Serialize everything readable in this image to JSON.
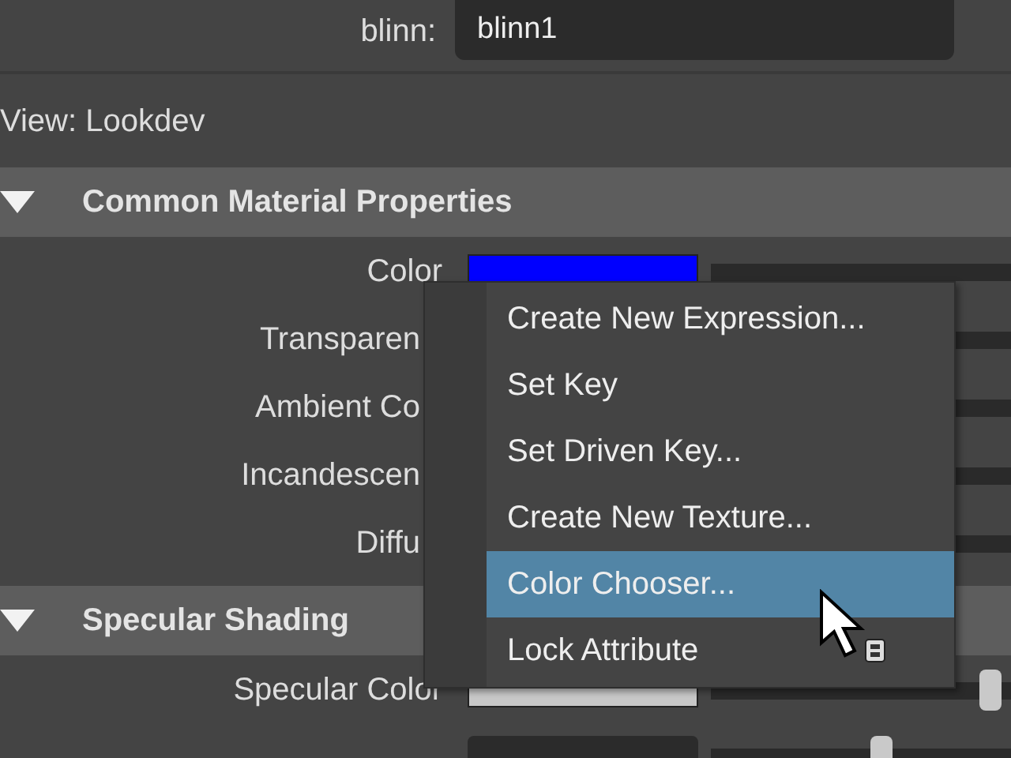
{
  "header": {
    "label": "blinn:",
    "value": "blinn1"
  },
  "view": {
    "label": "View: Lookdev"
  },
  "sections": [
    {
      "title": "Common Material Properties",
      "expanded": true,
      "attributes": [
        {
          "kind": "color",
          "label": "Color",
          "color": "#0000ff"
        },
        {
          "kind": "slot",
          "label": "Transparen"
        },
        {
          "kind": "slot",
          "label": "Ambient Co"
        },
        {
          "kind": "slot",
          "label": "Incandescen"
        },
        {
          "kind": "slot",
          "label": "Diffu"
        }
      ]
    },
    {
      "title": "Specular Shading",
      "expanded": true,
      "attributes": [
        {
          "kind": "color",
          "label": "Specular Color",
          "color": "#c8c8c8",
          "level": 0.93
        },
        {
          "kind": "number",
          "level": 0.57
        }
      ]
    }
  ],
  "context_menu": {
    "items": [
      {
        "label": "Create New Expression...",
        "selected": false
      },
      {
        "label": "Set Key",
        "selected": false
      },
      {
        "label": "Set Driven Key...",
        "selected": false
      },
      {
        "label": "Create New Texture...",
        "selected": false
      },
      {
        "label": "Color Chooser...",
        "selected": true
      },
      {
        "label": "Lock Attribute",
        "selected": false
      }
    ]
  }
}
